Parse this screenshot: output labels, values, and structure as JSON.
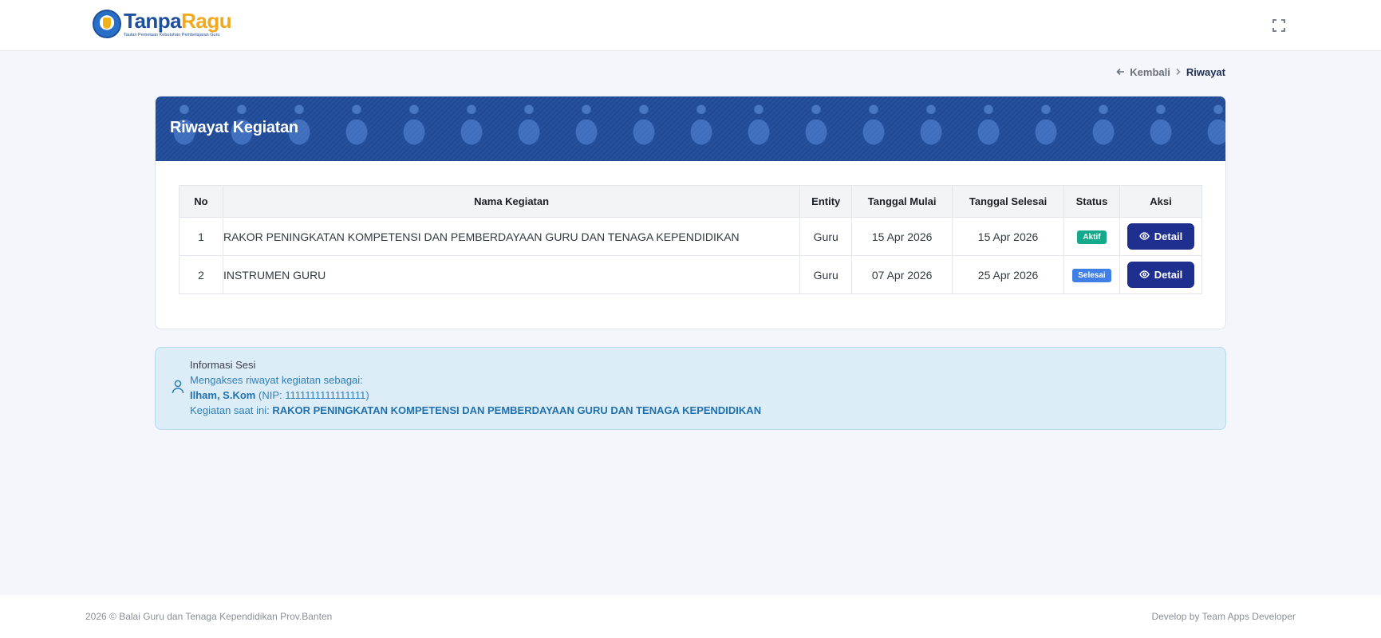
{
  "header": {
    "logo_part1": "Tanpa",
    "logo_part2": "Ragu",
    "logo_tagline": "Tautan Pemetaan Kebutuhan Pembelajaran Guru"
  },
  "breadcrumb": {
    "back_label": "Kembali",
    "current_label": "Riwayat"
  },
  "card": {
    "title": "Riwayat Kegiatan"
  },
  "table": {
    "headers": [
      "No",
      "Nama Kegiatan",
      "Entity",
      "Tanggal Mulai",
      "Tanggal Selesai",
      "Status",
      "Aksi"
    ],
    "rows": [
      {
        "no": "1",
        "name": "RAKOR PENINGKATAN KOMPETENSI DAN PEMBERDAYAAN GURU DAN TENAGA KEPENDIDIKAN",
        "entity": "Guru",
        "start": "15 Apr 2026",
        "end": "15 Apr 2026",
        "status": "Aktif",
        "status_color": "#14a98a",
        "action": "Detail"
      },
      {
        "no": "2",
        "name": "INSTRUMEN GURU",
        "entity": "Guru",
        "start": "07 Apr 2026",
        "end": "25 Apr 2026",
        "status": "Selesai",
        "status_color": "#3f7fe6",
        "action": "Detail"
      }
    ]
  },
  "session_info": {
    "title": "Informasi Sesi",
    "access_text": "Mengakses riwayat kegiatan sebagai:",
    "user_name": "Ilham, S.Kom",
    "user_nip": "(NIP: 1111111111111111)",
    "current_label": "Kegiatan saat ini:",
    "current_activity": "RAKOR PENINGKATAN KOMPETENSI DAN PEMBERDAYAAN GURU DAN TENAGA KEPENDIDIKAN"
  },
  "footer": {
    "left": "2026 © Balai Guru dan Tenaga Kependidikan Prov.Banten",
    "right": "Develop by Team Apps Developer"
  },
  "colors": {
    "primary": "#1f2f8f",
    "header_bg": "#1f4a98",
    "info_bg": "#dcedf8"
  },
  "icons": [
    "fullscreen-icon",
    "arrow-left-icon",
    "chevron-right-icon",
    "eye-icon",
    "user-icon"
  ]
}
